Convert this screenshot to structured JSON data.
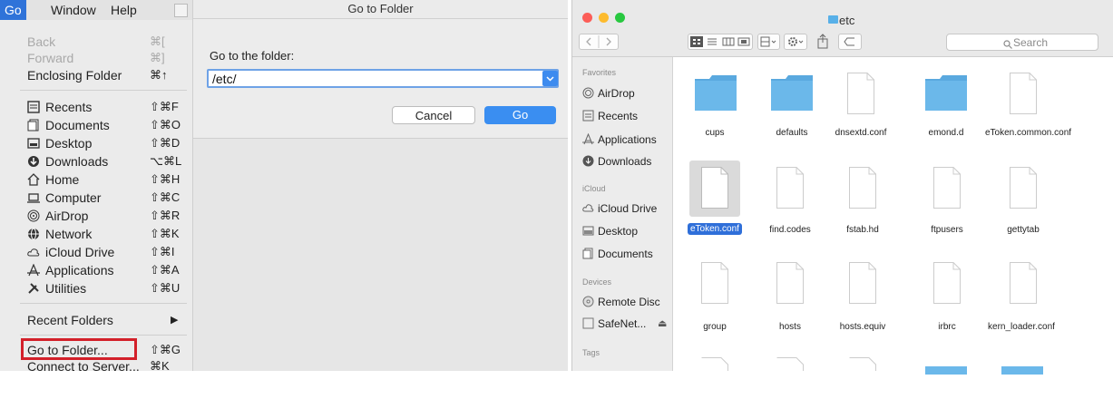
{
  "menubar": {
    "go": "Go",
    "window": "Window",
    "help": "Help"
  },
  "menu": {
    "items": [
      {
        "label": "Back",
        "shortcut": "⌘[",
        "disabled": true
      },
      {
        "label": "Forward",
        "shortcut": "⌘]",
        "disabled": true
      },
      {
        "label": "Enclosing Folder",
        "shortcut": "⌘↑"
      },
      {
        "label": "Recents",
        "shortcut": "⇧⌘F",
        "icon": "recents-icon"
      },
      {
        "label": "Documents",
        "shortcut": "⇧⌘O",
        "icon": "documents-icon"
      },
      {
        "label": "Desktop",
        "shortcut": "⇧⌘D",
        "icon": "desktop-icon"
      },
      {
        "label": "Downloads",
        "shortcut": "⌥⌘L",
        "icon": "downloads-icon"
      },
      {
        "label": "Home",
        "shortcut": "⇧⌘H",
        "icon": "home-icon"
      },
      {
        "label": "Computer",
        "shortcut": "⇧⌘C",
        "icon": "computer-icon"
      },
      {
        "label": "AirDrop",
        "shortcut": "⇧⌘R",
        "icon": "airdrop-icon"
      },
      {
        "label": "Network",
        "shortcut": "⇧⌘K",
        "icon": "network-icon"
      },
      {
        "label": "iCloud Drive",
        "shortcut": "⇧⌘I",
        "icon": "icloud-icon"
      },
      {
        "label": "Applications",
        "shortcut": "⇧⌘A",
        "icon": "applications-icon"
      },
      {
        "label": "Utilities",
        "shortcut": "⇧⌘U",
        "icon": "utilities-icon"
      },
      {
        "label": "Recent Folders",
        "shortcut": "▶"
      },
      {
        "label": "Go to Folder...",
        "shortcut": "⇧⌘G"
      },
      {
        "label": "Connect to Server...",
        "shortcut": "⌘K"
      }
    ]
  },
  "dialog": {
    "title": "Go to Folder",
    "prompt": "Go to the folder:",
    "path_value": "/etc/",
    "cancel_label": "Cancel",
    "go_label": "Go"
  },
  "finder": {
    "window_title": "etc",
    "search_placeholder": "Search",
    "sidebar": {
      "favorites_header": "Favorites",
      "favorites": [
        "AirDrop",
        "Recents",
        "Applications",
        "Downloads"
      ],
      "icloud_header": "iCloud",
      "icloud": [
        "iCloud Drive",
        "Desktop",
        "Documents"
      ],
      "devices_header": "Devices",
      "devices": [
        "Remote Disc",
        "SafeNet..."
      ],
      "tags_header": "Tags"
    },
    "files_row1": [
      "cups",
      "defaults",
      "dnsextd.conf",
      "emond.d",
      "eToken.common.conf"
    ],
    "files_row2": [
      "eToken.conf",
      "find.codes",
      "fstab.hd",
      "ftpusers",
      "gettytab"
    ],
    "files_row3": [
      "group",
      "hosts",
      "hosts.equiv",
      "irbrc",
      "kern_loader.conf"
    ],
    "selected_file": "eToken.conf",
    "accent_color": "#2f6fd9"
  }
}
